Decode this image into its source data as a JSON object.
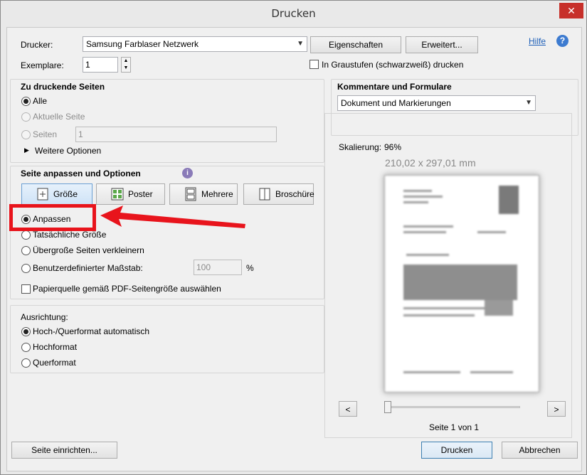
{
  "window": {
    "title": "Drucken",
    "close_glyph": "✕"
  },
  "printer": {
    "label": "Drucker:",
    "selected": "Samsung Farblaser Netzwerk",
    "properties_button": "Eigenschaften",
    "advanced_button": "Erweitert...",
    "help_link": "Hilfe",
    "copies_label": "Exemplare:",
    "copies_value": "1",
    "grayscale_label": "In Graustufen (schwarzweiß) drucken"
  },
  "pages_to_print": {
    "heading": "Zu druckende Seiten",
    "all": "Alle",
    "current_page": "Aktuelle Seite",
    "pages": "Seiten",
    "pages_value": "1",
    "more_options": "Weitere Optionen"
  },
  "page_sizing": {
    "heading": "Seite anpassen und Optionen",
    "tabs": [
      {
        "label": "Größe",
        "icon": "size-icon"
      },
      {
        "label": "Poster",
        "icon": "poster-icon"
      },
      {
        "label": "Mehrere",
        "icon": "multiple-icon"
      },
      {
        "label": "Broschüre",
        "icon": "booklet-icon"
      }
    ],
    "fit": "Anpassen",
    "actual_size": "Tatsächliche Größe",
    "shrink": "Übergroße Seiten verkleinern",
    "custom_scale": "Benutzerdefinierter Maßstab:",
    "custom_scale_value": "100",
    "percent": "%",
    "paper_source": "Papierquelle gemäß PDF-Seitengröße auswählen"
  },
  "orientation": {
    "heading": "Ausrichtung:",
    "auto": "Hoch-/Querformat automatisch",
    "portrait": "Hochformat",
    "landscape": "Querformat"
  },
  "comments": {
    "heading": "Kommentare und Formulare",
    "selected": "Dokument und Markierungen"
  },
  "preview": {
    "scaling_label": "Skalierung:",
    "scaling_value": "96%",
    "page_size": "210,02 x 297,01 mm",
    "prev_glyph": "<",
    "next_glyph": ">",
    "page_status": "Seite 1 von 1",
    "slider_position": 0
  },
  "footer": {
    "page_setup": "Seite einrichten...",
    "print": "Drucken",
    "cancel": "Abbrechen"
  },
  "colors": {
    "annotation_red": "#e8141c",
    "help_blue": "#1d5fb8"
  }
}
